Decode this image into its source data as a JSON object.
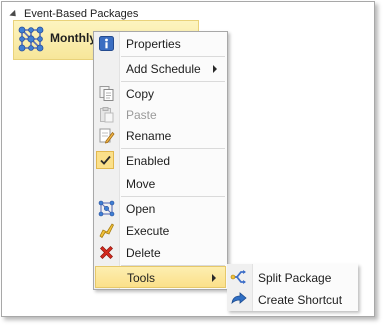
{
  "tree": {
    "group_label": "Event-Based Packages",
    "package_label": "Monthly"
  },
  "context_menu": {
    "items": [
      {
        "label": "Properties",
        "icon": "info-icon"
      },
      {
        "label": "Add Schedule",
        "icon": "none",
        "has_submenu": true
      },
      {
        "label": "Copy",
        "icon": "copy-icon"
      },
      {
        "label": "Paste",
        "icon": "paste-icon",
        "disabled": true
      },
      {
        "label": "Rename",
        "icon": "rename-icon"
      },
      {
        "label": "Enabled",
        "icon": "checkmark-icon",
        "checked": true
      },
      {
        "label": "Move",
        "icon": "none"
      },
      {
        "label": "Open",
        "icon": "open-icon"
      },
      {
        "label": "Execute",
        "icon": "execute-icon"
      },
      {
        "label": "Delete",
        "icon": "delete-icon"
      },
      {
        "label": "Tools",
        "icon": "none",
        "has_submenu": true,
        "highlighted": true
      }
    ]
  },
  "tools_submenu": {
    "items": [
      {
        "label": "Split Package",
        "icon": "split-package-icon"
      },
      {
        "label": "Create Shortcut",
        "icon": "create-shortcut-icon"
      }
    ]
  },
  "colors": {
    "highlight": "#fbe08a",
    "selection_fill": "#f7e69a",
    "delete_red": "#d42a1e"
  }
}
